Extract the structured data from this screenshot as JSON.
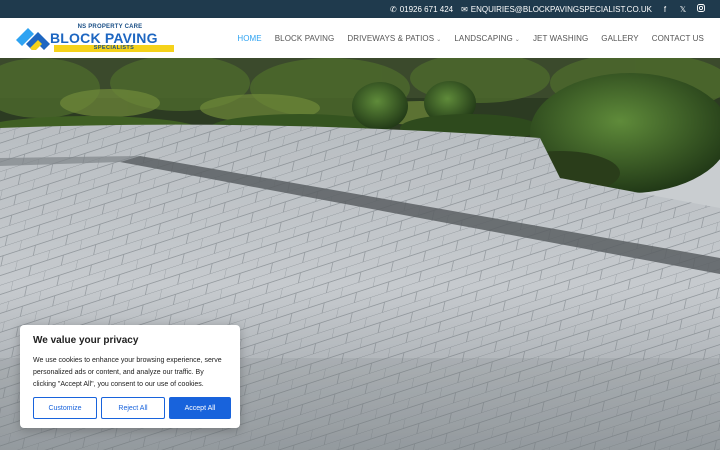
{
  "topbar": {
    "phone": "01926 671 424",
    "email": "ENQUIRIES@BLOCKPAVINGSPECIALIST.CO.UK",
    "social": [
      "facebook-icon",
      "x-icon",
      "instagram-icon"
    ]
  },
  "logo": {
    "line1": "NS PROPERTY CARE",
    "line2": "BLOCK PAVING",
    "line3": "SPECIALISTS"
  },
  "nav": {
    "items": [
      {
        "label": "HOME",
        "active": true
      },
      {
        "label": "BLOCK PAVING"
      },
      {
        "label": "DRIVEWAYS & PATIOS",
        "dropdown": true
      },
      {
        "label": "LANDSCAPING",
        "dropdown": true
      },
      {
        "label": "JET WASHING"
      },
      {
        "label": "GALLERY"
      },
      {
        "label": "CONTACT US"
      }
    ]
  },
  "cookie": {
    "title": "We value your privacy",
    "text": "We use cookies to enhance your browsing experience, serve personalized ads or content, and analyze our traffic. By clicking \"Accept All\", you consent to our use of cookies.",
    "customize": "Customize",
    "reject": "Reject All",
    "accept": "Accept All"
  },
  "colors": {
    "topbar": "#1f3a4d",
    "nav_active": "#2ea3f2",
    "brand_blue": "#1d66c1",
    "brand_yellow": "#f5d21a",
    "cookie_button": "#1863dc"
  }
}
